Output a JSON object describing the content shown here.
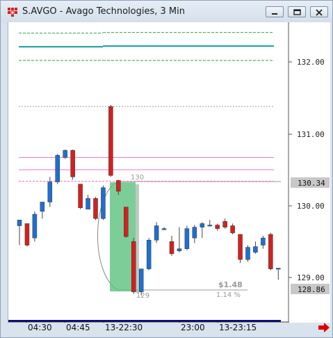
{
  "window": {
    "title": "S.AVGO - Avago Technologies, 3 Min",
    "buttons": [
      "minimize-icon",
      "restore-icon",
      "close-icon"
    ]
  },
  "colors": {
    "up_candle": "#1f6fd0",
    "down_candle": "#d42020",
    "green_level": "#22aa44",
    "teal_level": "#139a9a",
    "pink_level": "#f070c8",
    "gray_level": "#9a9a9a",
    "selection_fill": "#5cc07e",
    "price_box": "#c8c8c8"
  },
  "price_axis": {
    "ticks": [
      "132.00",
      "131.00",
      "130.00",
      "129.00"
    ],
    "current_price": "130.34",
    "marked_price": "128.86"
  },
  "time_axis": {
    "labels": [
      "04:30",
      "04:45",
      "13-22:30",
      "23:00",
      "13-23:15"
    ]
  },
  "annotation": {
    "high_label": "130",
    "low_label": "129",
    "dollar_change": "$1.48",
    "percent_change": "1.14 %"
  },
  "chart_data": {
    "type": "candlestick",
    "ylim": [
      128.55,
      132.55
    ],
    "candles": [
      {
        "o": 129.72,
        "h": 129.8,
        "l": 129.45,
        "c": 129.8
      },
      {
        "o": 129.75,
        "h": 129.75,
        "l": 129.43,
        "c": 129.45
      },
      {
        "o": 129.55,
        "h": 129.92,
        "l": 129.5,
        "c": 129.88
      },
      {
        "o": 129.92,
        "h": 130.05,
        "l": 129.82,
        "c": 130.05
      },
      {
        "o": 130.05,
        "h": 130.4,
        "l": 129.98,
        "c": 130.33
      },
      {
        "o": 130.33,
        "h": 130.72,
        "l": 130.3,
        "c": 130.7
      },
      {
        "o": 130.67,
        "h": 130.78,
        "l": 130.65,
        "c": 130.77
      },
      {
        "o": 130.77,
        "h": 130.78,
        "l": 130.36,
        "c": 130.4
      },
      {
        "o": 130.3,
        "h": 130.3,
        "l": 129.95,
        "c": 129.97
      },
      {
        "o": 129.95,
        "h": 130.15,
        "l": 129.95,
        "c": 130.1
      },
      {
        "o": 130.1,
        "h": 130.12,
        "l": 129.8,
        "c": 129.82
      },
      {
        "o": 129.82,
        "h": 130.28,
        "l": 129.8,
        "c": 130.25
      },
      {
        "o": 131.38,
        "h": 131.4,
        "l": 130.4,
        "c": 130.42
      },
      {
        "o": 130.35,
        "h": 130.36,
        "l": 130.15,
        "c": 130.2
      },
      {
        "o": 129.98,
        "h": 129.98,
        "l": 129.55,
        "c": 129.57
      },
      {
        "o": 129.5,
        "h": 129.55,
        "l": 128.77,
        "c": 128.8
      },
      {
        "o": 128.8,
        "h": 129.1,
        "l": 128.75,
        "c": 129.12
      },
      {
        "o": 129.12,
        "h": 129.55,
        "l": 129.1,
        "c": 129.52
      },
      {
        "o": 129.52,
        "h": 129.77,
        "l": 129.48,
        "c": 129.72
      },
      {
        "o": 129.68,
        "h": 129.7,
        "l": 129.66,
        "c": 129.68
      },
      {
        "o": 129.5,
        "h": 129.58,
        "l": 129.3,
        "c": 129.33
      },
      {
        "o": 129.37,
        "h": 129.7,
        "l": 129.35,
        "c": 129.4
      },
      {
        "o": 129.4,
        "h": 129.72,
        "l": 129.38,
        "c": 129.68
      },
      {
        "o": 129.55,
        "h": 129.73,
        "l": 129.48,
        "c": 129.7
      },
      {
        "o": 129.7,
        "h": 129.77,
        "l": 129.55,
        "c": 129.75
      },
      {
        "o": 129.73,
        "h": 129.8,
        "l": 129.71,
        "c": 129.73
      },
      {
        "o": 129.73,
        "h": 129.75,
        "l": 129.65,
        "c": 129.68
      },
      {
        "o": 129.78,
        "h": 129.82,
        "l": 129.68,
        "c": 129.7
      },
      {
        "o": 129.72,
        "h": 129.75,
        "l": 129.6,
        "c": 129.62
      },
      {
        "o": 129.6,
        "h": 129.6,
        "l": 129.2,
        "c": 129.25
      },
      {
        "o": 129.25,
        "h": 129.45,
        "l": 129.22,
        "c": 129.42
      },
      {
        "o": 129.35,
        "h": 129.5,
        "l": 129.33,
        "c": 129.43
      },
      {
        "o": 129.45,
        "h": 129.58,
        "l": 129.4,
        "c": 129.55
      },
      {
        "o": 129.6,
        "h": 129.62,
        "l": 129.1,
        "c": 129.12
      },
      {
        "o": 129.12,
        "h": 129.13,
        "l": 128.97,
        "c": 129.13
      }
    ],
    "levels": [
      {
        "price": 132.41,
        "color": "green",
        "style": "dashed"
      },
      {
        "price": 132.22,
        "color": "teal",
        "style": "solid"
      },
      {
        "price": 132.02,
        "color": "green",
        "style": "dashed"
      },
      {
        "price": 131.38,
        "color": "gray",
        "style": "dashed"
      },
      {
        "price": 130.67,
        "color": "pink",
        "style": "solid"
      },
      {
        "price": 130.5,
        "color": "pink",
        "style": "solid"
      },
      {
        "price": 130.34,
        "color": "pink",
        "style": "dashed"
      }
    ]
  }
}
